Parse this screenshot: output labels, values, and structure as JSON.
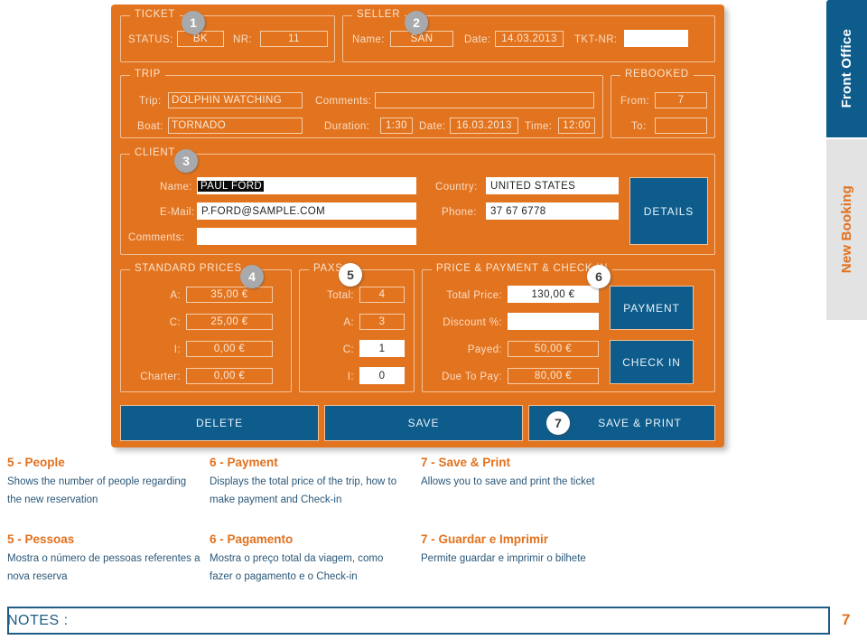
{
  "sidebar": {
    "tabs": [
      {
        "label": "Front Office",
        "state": "active",
        "color": "#0d5c8c"
      },
      {
        "label": "New Booking",
        "state": "inactive",
        "color": "#e3e3e3"
      }
    ]
  },
  "theme": {
    "panel_orange": "#e2741f",
    "button_blue": "#0d5c8c",
    "heading_orange": "#e2711d",
    "body_navy": "#2a5779",
    "badge_grey": "#a7a9ac",
    "badge_white": "#ffffff"
  },
  "app": {
    "ticket": {
      "legend": "TICKET",
      "badge": "1",
      "status_label": "STATUS:",
      "status_value": "BK",
      "nr_label": "NR:",
      "nr_value": "11"
    },
    "seller": {
      "legend": "SELLER",
      "badge": "2",
      "name_label": "Name:",
      "name_value": "SAN",
      "date_label": "Date:",
      "date_value": "14.03.2013",
      "tkt_nr_label": "TKT-NR:",
      "tkt_nr_value": ""
    },
    "trip": {
      "legend": "TRIP",
      "trip_label": "Trip:",
      "trip_value": "DOLPHIN WATCHING",
      "boat_label": "Boat:",
      "boat_value": "TORNADO",
      "comments_label": "Comments:",
      "comments_value": "",
      "duration_label": "Duration:",
      "duration_value": "1:30",
      "date_label": "Date:",
      "date_value": "16.03.2013",
      "time_label": "Time:",
      "time_value": "12:00"
    },
    "rebooked": {
      "legend": "REBOOKED",
      "from_label": "From:",
      "from_value": "7",
      "to_label": "To:",
      "to_value": ""
    },
    "client": {
      "legend": "CLIENT",
      "badge": "3",
      "name_label": "Name:",
      "name_value": "PAUL FORD",
      "email_label": "E-Mail:",
      "email_value": "P.FORD@SAMPLE.COM",
      "comments_label": "Comments:",
      "comments_value": "",
      "country_label": "Country:",
      "country_value": "UNITED STATES",
      "phone_label": "Phone:",
      "phone_value": "37 67 6778",
      "details_button": "DETAILS"
    },
    "standard_prices": {
      "legend": "STANDARD PRICES",
      "badge": "4",
      "rows": [
        {
          "label": "A:",
          "value": "35,00 €"
        },
        {
          "label": "C:",
          "value": "25,00 €"
        },
        {
          "label": "I:",
          "value": "0,00 €"
        },
        {
          "label": "Charter:",
          "value": "0,00 €"
        }
      ]
    },
    "paxs": {
      "legend": "PAXS",
      "badge": "5",
      "rows": [
        {
          "label": "Total:",
          "value": "4",
          "white": false
        },
        {
          "label": "A:",
          "value": "3",
          "white": false
        },
        {
          "label": "C:",
          "value": "1",
          "white": true
        },
        {
          "label": "I:",
          "value": "0",
          "white": true
        }
      ]
    },
    "price_payment": {
      "legend": "PRICE & PAYMENT & CHECK IN",
      "badge": "6",
      "rows": [
        {
          "label": "Total Price:",
          "value": "130,00 €",
          "white": true
        },
        {
          "label": "Discount %:",
          "value": "",
          "white": true
        },
        {
          "label": "Payed:",
          "value": "50,00 €",
          "white": false
        },
        {
          "label": "Due To Pay:",
          "value": "80,00 €",
          "white": false
        }
      ],
      "payment_button": "PAYMENT",
      "checkin_button": "CHECK IN"
    },
    "actions": {
      "delete": "DELETE",
      "save": "SAVE",
      "save_print": "SAVE & PRINT",
      "save_print_badge": "7"
    }
  },
  "captions_en": [
    {
      "title": "5 - People",
      "body": "Shows the number of people regarding the new reservation"
    },
    {
      "title": "6 -  Payment",
      "body": "Displays the total price of the trip, how to make payment and Check-in"
    },
    {
      "title": "7 - Save & Print",
      "body": "Allows you to save and print the ticket"
    }
  ],
  "captions_pt": [
    {
      "title": "5 - Pessoas",
      "body": "Mostra o número de pessoas referentes a nova reserva"
    },
    {
      "title": "6 - Pagamento",
      "body": "Mostra o preço total da viagem, como fazer o pagamento e o Check-in"
    },
    {
      "title": "7 - Guardar e Imprimir",
      "body": "Permite guardar e imprimir o bilhete"
    }
  ],
  "footer": {
    "notes_label": "NOTES :",
    "page_number": "7"
  }
}
